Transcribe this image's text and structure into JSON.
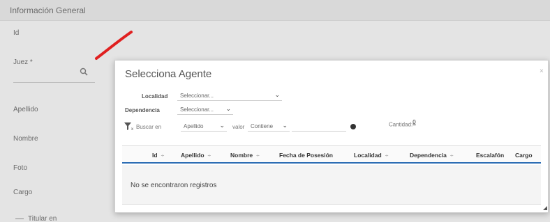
{
  "background_form": {
    "section_title": "Información General",
    "labels": {
      "id": "Id",
      "juez": "Juez *",
      "apellido": "Apellido",
      "nombre": "Nombre",
      "foto": "Foto",
      "cargo": "Cargo",
      "titular": "Titular en"
    },
    "annotation_color": "#e02020"
  },
  "modal": {
    "title": "Selecciona Agente",
    "close_symbol": "×",
    "filters": {
      "localidad_label": "Localidad",
      "localidad_value": "Seleccionar...",
      "dependencia_label": "Dependencia",
      "dependencia_value": "Seleccionar...",
      "buscar_label": "Buscar en",
      "buscar_field": "Apellido",
      "valor_label": "valor",
      "valor_operator": "Contiene",
      "valor_text": "",
      "cantidad_label": "Cantidad:",
      "cantidad_value": "0"
    },
    "table": {
      "columns": [
        "Id",
        "Apellido",
        "Nombre",
        "Fecha de Posesión",
        "Localidad",
        "Dependencia",
        "Escalafón",
        "Cargo"
      ],
      "sort_symbol": "÷",
      "empty_message": "No se encontraron registros"
    },
    "accent_color": "#2c6db4"
  }
}
